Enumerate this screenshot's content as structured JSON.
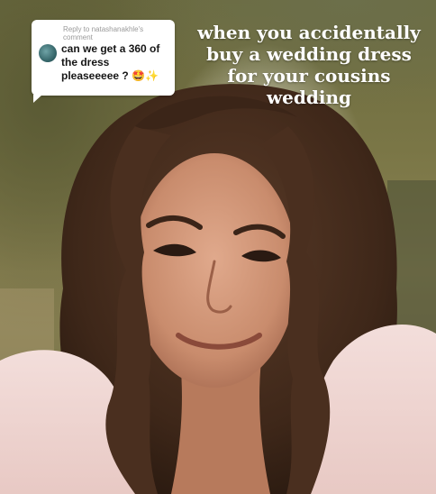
{
  "reply_card": {
    "header": "Reply to natashanakhle's comment",
    "comment": "can we get a 360 of the dress pleaseeeee ?",
    "emoji": "🤩✨",
    "avatar_icon": "user-avatar"
  },
  "caption": {
    "line1": "when you accidentally",
    "line2": "buy a wedding dress",
    "line3": "for your cousins",
    "line4": "wedding"
  }
}
